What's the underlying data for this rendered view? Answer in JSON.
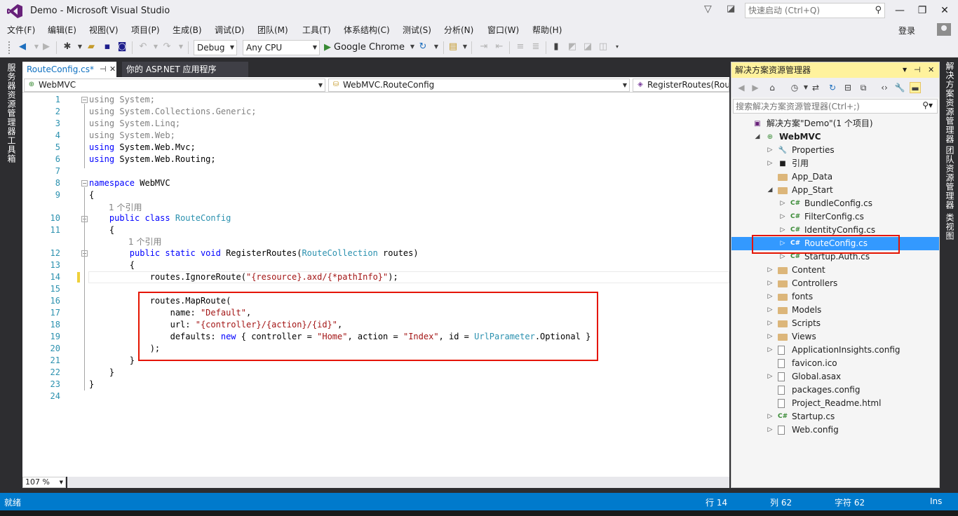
{
  "window": {
    "title": "Demo - Microsoft Visual Studio",
    "quick_launch_placeholder": "快速启动 (Ctrl+Q)",
    "minimize": "—",
    "restore": "❐",
    "close": "✕"
  },
  "menu": {
    "items": [
      "文件(F)",
      "编辑(E)",
      "视图(V)",
      "项目(P)",
      "生成(B)",
      "调试(D)",
      "团队(M)",
      "工具(T)",
      "体系结构(C)",
      "测试(S)",
      "分析(N)",
      "窗口(W)",
      "帮助(H)"
    ],
    "login": "登录"
  },
  "toolbar": {
    "config": "Debug",
    "platform": "Any CPU",
    "run_target": "Google Chrome"
  },
  "left_tabs": [
    "服务器资源管理器",
    "工具箱"
  ],
  "right_tabs": [
    "解决方案资源管理器",
    "团队资源管理器",
    "类视图"
  ],
  "tabs": {
    "active": "RouteConfig.cs*",
    "active_pin": "⊣",
    "active_close": "✕",
    "inactive": "你的 ASP.NET 应用程序"
  },
  "navbar": {
    "project": "WebMVC",
    "class": "WebMVC.RouteConfig",
    "member": "RegisterRoutes(RouteCollection routes)"
  },
  "editor": {
    "zoom": "107 %",
    "codelens": "1 个引用",
    "lines": [
      {
        "n": "1",
        "parts": [
          [
            "g",
            "using System;"
          ]
        ]
      },
      {
        "n": "2",
        "parts": [
          [
            "g",
            "using System.Collections.Generic;"
          ]
        ]
      },
      {
        "n": "3",
        "parts": [
          [
            "g",
            "using System.Linq;"
          ]
        ]
      },
      {
        "n": "4",
        "parts": [
          [
            "g",
            "using System.Web;"
          ]
        ]
      },
      {
        "n": "5",
        "parts": [
          [
            "k",
            "using"
          ],
          [
            "",
            " System.Web.Mvc;"
          ]
        ]
      },
      {
        "n": "6",
        "parts": [
          [
            "k",
            "using"
          ],
          [
            "",
            " System.Web.Routing;"
          ]
        ]
      },
      {
        "n": "7",
        "parts": []
      },
      {
        "n": "8",
        "parts": [
          [
            "k",
            "namespace"
          ],
          [
            "",
            " WebMVC"
          ]
        ]
      },
      {
        "n": "9",
        "parts": [
          [
            "",
            "{"
          ]
        ]
      },
      {
        "n": "10",
        "parts": [
          [
            "",
            "    "
          ],
          [
            "k",
            "public class"
          ],
          [
            "",
            " "
          ],
          [
            "t",
            "RouteConfig"
          ]
        ]
      },
      {
        "n": "11",
        "parts": [
          [
            "",
            "    {"
          ]
        ]
      },
      {
        "n": "12",
        "parts": [
          [
            "",
            "        "
          ],
          [
            "k",
            "public static void"
          ],
          [
            "",
            " RegisterRoutes("
          ],
          [
            "t",
            "RouteCollection"
          ],
          [
            "",
            " routes)"
          ]
        ]
      },
      {
        "n": "13",
        "parts": [
          [
            "",
            "        {"
          ]
        ]
      },
      {
        "n": "14",
        "parts": [
          [
            "",
            "            routes.IgnoreRoute("
          ],
          [
            "s",
            "\"{resource}.axd/{*pathInfo}\""
          ],
          [
            "",
            ");"
          ]
        ]
      },
      {
        "n": "15",
        "parts": []
      },
      {
        "n": "16",
        "parts": [
          [
            "",
            "            routes.MapRoute("
          ]
        ]
      },
      {
        "n": "17",
        "parts": [
          [
            "",
            "                name: "
          ],
          [
            "s",
            "\"Default\""
          ],
          [
            "",
            ","
          ]
        ]
      },
      {
        "n": "18",
        "parts": [
          [
            "",
            "                url: "
          ],
          [
            "s",
            "\"{controller}/{action}/{id}\""
          ],
          [
            "",
            ","
          ]
        ]
      },
      {
        "n": "19",
        "parts": [
          [
            "",
            "                defaults: "
          ],
          [
            "k",
            "new"
          ],
          [
            "",
            " { controller = "
          ],
          [
            "s",
            "\"Home\""
          ],
          [
            "",
            ", action = "
          ],
          [
            "s",
            "\"Index\""
          ],
          [
            "",
            ", id = "
          ],
          [
            "t",
            "UrlParameter"
          ],
          [
            "",
            ".Optional }"
          ]
        ]
      },
      {
        "n": "20",
        "parts": [
          [
            "",
            "            );"
          ]
        ]
      },
      {
        "n": "21",
        "parts": [
          [
            "",
            "        }"
          ]
        ]
      },
      {
        "n": "22",
        "parts": [
          [
            "",
            "    }"
          ]
        ]
      },
      {
        "n": "23",
        "parts": [
          [
            "",
            "}"
          ]
        ]
      },
      {
        "n": "24",
        "parts": []
      }
    ]
  },
  "solution_explorer": {
    "title": "解决方案资源管理器",
    "search_placeholder": "搜索解决方案资源管理器(Ctrl+;)",
    "nodes": [
      {
        "label": "解决方案\"Demo\"(1 个项目)",
        "depth": 0,
        "tw": "",
        "icon": "solution-icon",
        "glyph": "▣",
        "kind": "sol",
        "bold": false
      },
      {
        "label": "WebMVC",
        "depth": 1,
        "tw": "◢",
        "icon": "web-project-icon",
        "glyph": "⊕",
        "kind": "proj",
        "bold": true
      },
      {
        "label": "Properties",
        "depth": 2,
        "tw": "▷",
        "icon": "wrench-icon",
        "glyph": "🔧",
        "kind": "prop",
        "bold": false
      },
      {
        "label": "引用",
        "depth": 2,
        "tw": "▷",
        "icon": "references-icon",
        "glyph": "■",
        "kind": "ref",
        "bold": false
      },
      {
        "label": "App_Data",
        "depth": 2,
        "tw": "",
        "icon": "folder-icon",
        "glyph": "",
        "kind": "folder",
        "bold": false
      },
      {
        "label": "App_Start",
        "depth": 2,
        "tw": "◢",
        "icon": "folder-open-icon",
        "glyph": "",
        "kind": "folder",
        "bold": false
      },
      {
        "label": "BundleConfig.cs",
        "depth": 3,
        "tw": "▷",
        "icon": "csharp-file-icon",
        "glyph": "C#",
        "kind": "cs",
        "bold": false
      },
      {
        "label": "FilterConfig.cs",
        "depth": 3,
        "tw": "▷",
        "icon": "csharp-file-icon",
        "glyph": "C#",
        "kind": "cs",
        "bold": false
      },
      {
        "label": "IdentityConfig.cs",
        "depth": 3,
        "tw": "▷",
        "icon": "csharp-file-icon",
        "glyph": "C#",
        "kind": "cs",
        "bold": false
      },
      {
        "label": "RouteConfig.cs",
        "depth": 3,
        "tw": "▷",
        "icon": "csharp-file-icon",
        "glyph": "C#",
        "kind": "cs",
        "bold": false,
        "selected": true
      },
      {
        "label": "Startup.Auth.cs",
        "depth": 3,
        "tw": "▷",
        "icon": "csharp-file-icon",
        "glyph": "C#",
        "kind": "cs",
        "bold": false
      },
      {
        "label": "Content",
        "depth": 2,
        "tw": "▷",
        "icon": "folder-icon",
        "glyph": "",
        "kind": "folder",
        "bold": false
      },
      {
        "label": "Controllers",
        "depth": 2,
        "tw": "▷",
        "icon": "folder-icon",
        "glyph": "",
        "kind": "folder",
        "bold": false
      },
      {
        "label": "fonts",
        "depth": 2,
        "tw": "▷",
        "icon": "folder-icon",
        "glyph": "",
        "kind": "folder",
        "bold": false
      },
      {
        "label": "Models",
        "depth": 2,
        "tw": "▷",
        "icon": "folder-icon",
        "glyph": "",
        "kind": "folder",
        "bold": false
      },
      {
        "label": "Scripts",
        "depth": 2,
        "tw": "▷",
        "icon": "folder-icon",
        "glyph": "",
        "kind": "folder",
        "bold": false
      },
      {
        "label": "Views",
        "depth": 2,
        "tw": "▷",
        "icon": "folder-icon",
        "glyph": "",
        "kind": "folder",
        "bold": false
      },
      {
        "label": "ApplicationInsights.config",
        "depth": 2,
        "tw": "▷",
        "icon": "config-file-icon",
        "glyph": "",
        "kind": "file",
        "bold": false
      },
      {
        "label": "favicon.ico",
        "depth": 2,
        "tw": "",
        "icon": "file-icon",
        "glyph": "",
        "kind": "file",
        "bold": false
      },
      {
        "label": "Global.asax",
        "depth": 2,
        "tw": "▷",
        "icon": "global-asax-icon",
        "glyph": "",
        "kind": "file",
        "bold": false
      },
      {
        "label": "packages.config",
        "depth": 2,
        "tw": "",
        "icon": "file-icon",
        "glyph": "",
        "kind": "file",
        "bold": false
      },
      {
        "label": "Project_Readme.html",
        "depth": 2,
        "tw": "",
        "icon": "html-file-icon",
        "glyph": "",
        "kind": "file",
        "bold": false
      },
      {
        "label": "Startup.cs",
        "depth": 2,
        "tw": "▷",
        "icon": "csharp-file-icon",
        "glyph": "C#",
        "kind": "cs",
        "bold": false
      },
      {
        "label": "Web.config",
        "depth": 2,
        "tw": "▷",
        "icon": "config-file-icon",
        "glyph": "",
        "kind": "file",
        "bold": false
      }
    ]
  },
  "status": {
    "ready": "就绪",
    "line": "行 14",
    "col": "列 62",
    "char": "字符 62",
    "mode": "Ins"
  },
  "colors": {
    "accent": "#007acc",
    "keyword": "#0000ff",
    "type": "#2b91af",
    "string": "#a31515",
    "highlight_box": "#e51400",
    "se_title": "#fff29d",
    "selection": "#3399ff"
  }
}
